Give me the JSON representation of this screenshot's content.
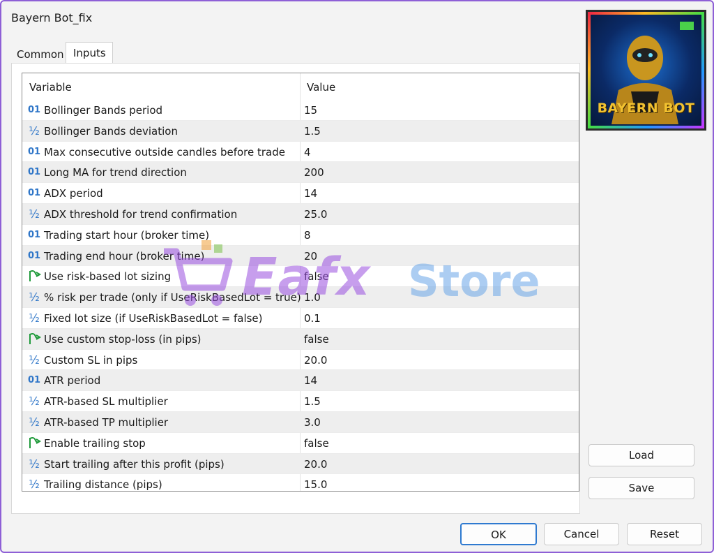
{
  "window": {
    "title": "Bayern Bot_fix"
  },
  "tabs": [
    {
      "label": "Common"
    },
    {
      "label": "Inputs"
    }
  ],
  "grid": {
    "header_variable": "Variable",
    "header_value": "Value",
    "rows": [
      {
        "type": "int",
        "icon_text": "01",
        "name": "Bollinger Bands period",
        "value": "15"
      },
      {
        "type": "double",
        "icon_text": "½",
        "name": "Bollinger Bands deviation",
        "value": "1.5"
      },
      {
        "type": "int",
        "icon_text": "01",
        "name": "Max consecutive outside candles before trade",
        "value": "4"
      },
      {
        "type": "int",
        "icon_text": "01",
        "name": "Long MA for trend direction",
        "value": "200"
      },
      {
        "type": "int",
        "icon_text": "01",
        "name": "ADX period",
        "value": "14"
      },
      {
        "type": "double",
        "icon_text": "½",
        "name": "ADX threshold for trend confirmation",
        "value": "25.0"
      },
      {
        "type": "int",
        "icon_text": "01",
        "name": "Trading start hour (broker time)",
        "value": "8"
      },
      {
        "type": "int",
        "icon_text": "01",
        "name": "Trading end hour (broker time)",
        "value": "20"
      },
      {
        "type": "bool",
        "icon_text": "",
        "name": "Use risk-based lot sizing",
        "value": "false"
      },
      {
        "type": "double",
        "icon_text": "½",
        "name": "% risk per trade (only if UseRiskBasedLot = true)",
        "value": "1.0"
      },
      {
        "type": "double",
        "icon_text": "½",
        "name": "Fixed lot size (if UseRiskBasedLot = false)",
        "value": "0.1"
      },
      {
        "type": "bool",
        "icon_text": "",
        "name": "Use custom stop-loss (in pips)",
        "value": "false"
      },
      {
        "type": "double",
        "icon_text": "½",
        "name": "Custom SL in pips",
        "value": "20.0"
      },
      {
        "type": "int",
        "icon_text": "01",
        "name": "ATR period",
        "value": "14"
      },
      {
        "type": "double",
        "icon_text": "½",
        "name": "ATR-based SL multiplier",
        "value": "1.5"
      },
      {
        "type": "double",
        "icon_text": "½",
        "name": "ATR-based TP multiplier",
        "value": "3.0"
      },
      {
        "type": "bool",
        "icon_text": "",
        "name": "Enable trailing stop",
        "value": "false"
      },
      {
        "type": "double",
        "icon_text": "½",
        "name": "Start trailing after this profit (pips)",
        "value": "20.0"
      },
      {
        "type": "double",
        "icon_text": "½",
        "name": "Trailing distance (pips)",
        "value": "15.0"
      }
    ]
  },
  "watermark": {
    "part1": "Eafx",
    "part2": "Store"
  },
  "logo": {
    "caption": "BAYERN BOT"
  },
  "side_buttons": {
    "load": "Load",
    "save": "Save"
  },
  "footer_buttons": {
    "ok": "OK",
    "cancel": "Cancel",
    "reset": "Reset"
  },
  "colors": {
    "accent": "#2f7ad0",
    "window_border": "#8e5fd6",
    "int_icon": "#2f76c8",
    "bool_icon": "#1f9a3a"
  }
}
